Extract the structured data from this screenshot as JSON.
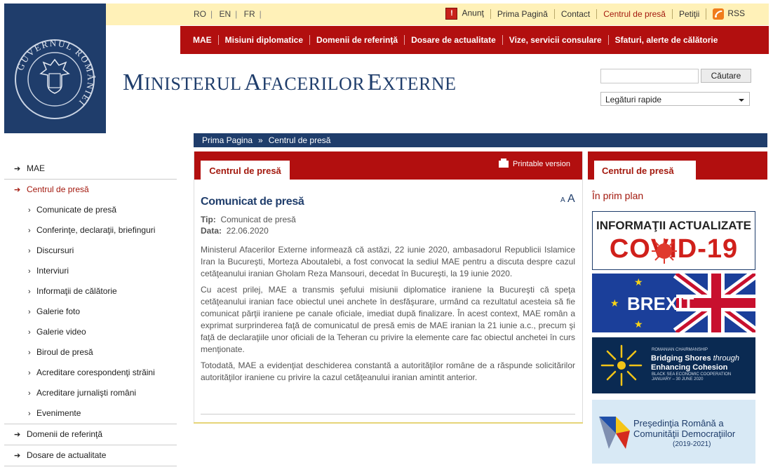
{
  "languages": [
    "RO",
    "EN",
    "FR"
  ],
  "top_links": {
    "anunt": "Anunţ",
    "home": "Prima Pagină",
    "contact": "Contact",
    "press": "Centrul de presă",
    "petitions": "Petiţii",
    "rss": "RSS"
  },
  "main_nav": [
    "MAE",
    "Misiuni diplomatice",
    "Domenii de referinţă",
    "Dosare de actualitate",
    "Vize, servicii consulare",
    "Sfaturi, alerte de călătorie"
  ],
  "logo": {
    "ring_text": "GUVERNUL ROMÂNIEI"
  },
  "site_title": {
    "w1_cap": "M",
    "w1_rest": "INISTERUL",
    "w2_cap": "A",
    "w2_rest": "FACERILOR",
    "w3_cap": "E",
    "w3_rest": "XTERNE"
  },
  "search": {
    "value": "",
    "button": "Căutare",
    "quick_links": "Legături rapide"
  },
  "breadcrumb": {
    "home": "Prima Pagina",
    "sep": "»",
    "current": "Centrul de presă"
  },
  "sidebar": {
    "mae": "MAE",
    "press_center": "Centrul de presă",
    "sub_items": [
      "Comunicate de presă",
      "Conferinţe, declaraţii, briefinguri",
      "Discursuri",
      "Interviuri",
      "Informaţii de călătorie",
      "Galerie foto",
      "Galerie video",
      "Biroul de presă",
      "Acreditare corespondenţi străini",
      "Acreditare jurnalişti români",
      "Evenimente"
    ],
    "domains": "Domenii de referinţă",
    "dossiers": "Dosare de actualitate"
  },
  "main": {
    "tab": "Centrul de presă",
    "printable": "Printable version",
    "title": "Comunicat de presă",
    "font_small": "A",
    "font_large": "A",
    "type_label": "Tip:",
    "type_value": "Comunicat de presă",
    "date_label": "Data:",
    "date_value": "22.06.2020",
    "paragraphs": [
      "Ministerul Afacerilor Externe informează că astăzi, 22 iunie 2020, ambasadorul Republicii Islamice Iran la Bucureşti, Morteza Aboutalebi, a fost convocat la sediul MAE pentru a discuta despre cazul cetăţeanului iranian Gholam Reza Mansouri, decedat în Bucureşti, la 19 iunie 2020.",
      "Cu acest prilej, MAE a transmis şefului misiunii diplomatice iraniene la Bucureşti că speţa cetăţeanului iranian face obiectul unei anchete în desfăşurare, urmând ca rezultatul acesteia să fie comunicat părţii iraniene pe canale oficiale, imediat după finalizare. În acest context, MAE român a exprimat surprinderea faţă de comunicatul de presă emis de MAE iranian la 21 iunie a.c., precum şi faţă de declaraţiile unor oficiali de la Teheran cu privire la elemente care fac obiectul anchetei în curs menţionate.",
      "Totodată, MAE a evidenţiat deschiderea constantă a autorităţilor române de a răspunde solicitărilor autorităţilor iraniene cu privire la cazul cetăţeanului iranian amintit anterior."
    ]
  },
  "right": {
    "tab": "Centrul de presă",
    "heading": "În prim plan",
    "covid_line1": "INFORMAŢII ACTUALIZATE",
    "covid_line2": "COVID-19",
    "brexit": "BREXIT",
    "bsec_small": "ROMANIAN CHAIRMANSHIP",
    "bsec_line1": "Bridging Shores",
    "bsec_through": "through",
    "bsec_line2": "Enhancing Cohesion",
    "bsec_org": "BLACK SEA ECONOMIC COOPERATION",
    "bsec_dates": "JANUARY – 30 JUNE 2020",
    "pres_line1": "Preşedinţia Română a",
    "pres_line2": "Comunităţii Democraţiilor",
    "pres_years": "(2019-2021)"
  },
  "colors": {
    "red": "#b20f0f",
    "navy": "#1f3d6b",
    "yellow_band": "#fff1b8"
  }
}
